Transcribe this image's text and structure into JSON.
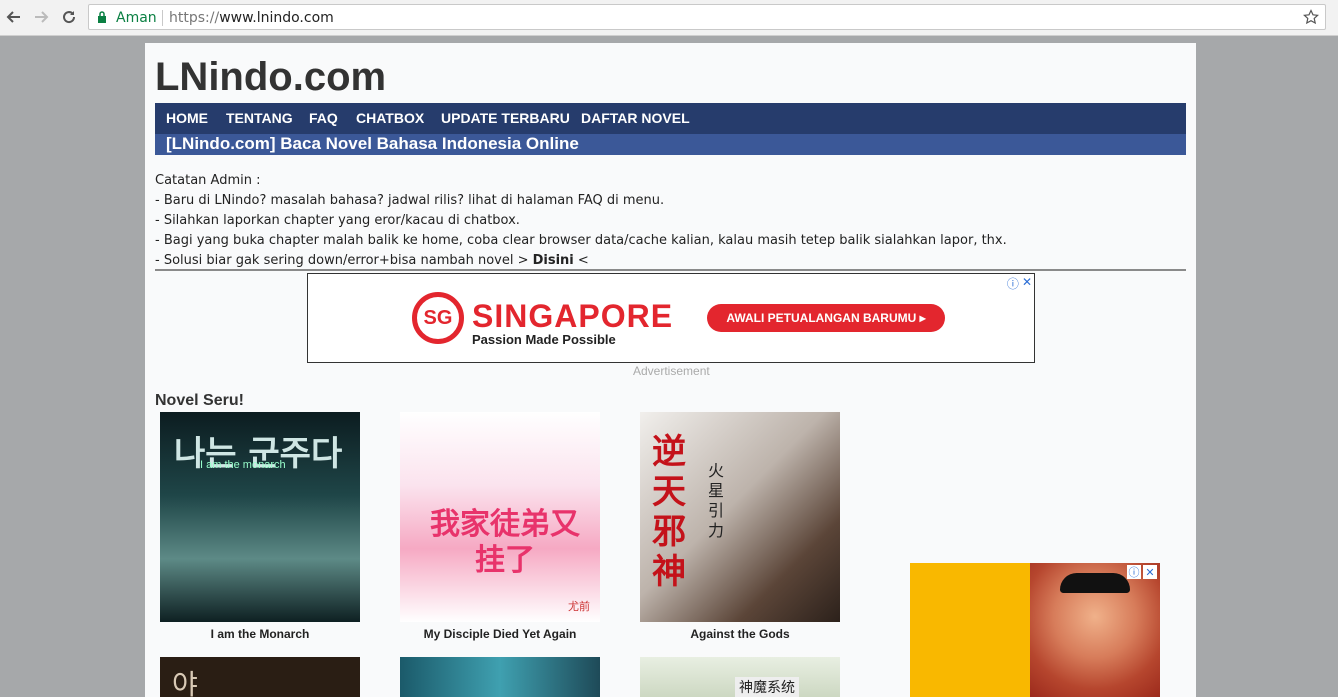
{
  "browser": {
    "secure_label": "Aman",
    "url_scheme": "https://",
    "url_host": "www.lnindo.com"
  },
  "site": {
    "title": "LNindo.com",
    "menu": [
      "HOME",
      "TENTANG",
      "FAQ",
      "CHATBOX",
      "UPDATE TERBARU",
      "DAFTAR NOVEL"
    ],
    "tagline": "[LNindo.com] Baca Novel Bahasa Indonesia Online"
  },
  "notes": {
    "heading": "Catatan Admin :",
    "lines": [
      "- Baru di LNindo? masalah bahasa? jadwal rilis? lihat di halaman FAQ di menu.",
      "- Silahkan laporkan chapter yang eror/kacau di chatbox.",
      "- Bagi yang buka chapter malah balik ke home, coba clear browser data/cache kalian, kalau masih tetep balik sialahkan lapor, thx."
    ],
    "last_prefix": "- Solusi biar gak sering down/error+bisa nambah novel > ",
    "last_link": "Disini",
    "last_suffix": " <"
  },
  "ad_banner": {
    "logo": "SG",
    "brand": "SINGAPORE",
    "tagline": "Passion Made Possible",
    "cta": "AWALI PETUALANGAN BARUMU ▸",
    "label": "Advertisement"
  },
  "novels": {
    "section_title": "Novel Seru!",
    "items": [
      {
        "title": "I am the Monarch",
        "cover_text": "나는 군주다",
        "cover_sub": "I am the monarch",
        "colors": [
          "#0f2a2e",
          "#4f7a7a"
        ]
      },
      {
        "title": "My Disciple Died Yet Again",
        "cover_text": "我家徒弟又挂了",
        "cover_sub": "尤前",
        "colors": [
          "#fbe7ef",
          "#f18fb0"
        ]
      },
      {
        "title": "Against the Gods",
        "cover_text": "逆天邪神",
        "cover_sub": "火星引力",
        "colors": [
          "#d9d4cf",
          "#7a5a4b"
        ]
      }
    ],
    "row2_texts": [
      "야",
      "",
      "神魔系统"
    ]
  },
  "icons": {
    "back": "arrow-left-icon",
    "forward": "arrow-right-icon",
    "reload": "reload-icon",
    "lock": "lock-icon",
    "star": "star-icon",
    "adinfo": "info-icon",
    "adclose": "close-icon"
  },
  "colors": {
    "menu_bg": "#263c6c",
    "tagline_bg": "#3b5898",
    "ad_red": "#e3262e",
    "ad2_bg": "#f9b800"
  }
}
